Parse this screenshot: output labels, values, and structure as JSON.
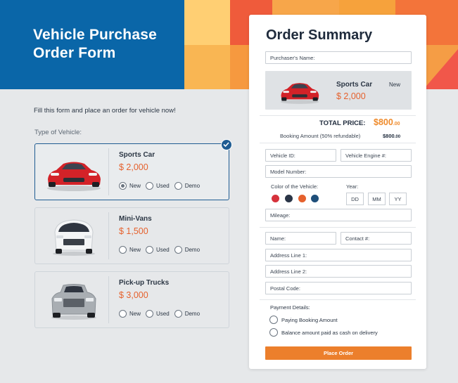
{
  "header": {
    "title": "Vehicle Purchase Order Form"
  },
  "intro_text": "Fill this form and place an order for vehicle now!",
  "vehicle_type_label": "Type of Vehicle:",
  "vehicles": [
    {
      "name": "Sports Car",
      "price": "$ 2,000",
      "icon": "sports-car-icon",
      "selected": true,
      "options": [
        "New",
        "Used",
        "Demo"
      ],
      "checked_option": "New"
    },
    {
      "name": "Mini-Vans",
      "price": "$ 1,500",
      "icon": "minivan-icon",
      "selected": false,
      "options": [
        "New",
        "Used",
        "Demo"
      ],
      "checked_option": null
    },
    {
      "name": "Pick-up Trucks",
      "price": "$ 3,000",
      "icon": "pickup-truck-icon",
      "selected": false,
      "options": [
        "New",
        "Used",
        "Demo"
      ],
      "checked_option": null
    }
  ],
  "order_summary": {
    "title": "Order Summary",
    "purchaser_placeholder": "Purchaser's Name:",
    "item": {
      "name": "Sports Car",
      "price": "$ 2,000",
      "condition": "New"
    },
    "total_label": "TOTAL PRICE:",
    "total_value": "$800",
    "total_cents": ".00",
    "booking_label": "Booking Amount (50% refundable)",
    "booking_value": "$800",
    "booking_cents": ".00",
    "fields": {
      "vehicle_id": "Vehicle ID:",
      "engine_no": "Vehicle Engine #:",
      "model_no": "Model Number:",
      "color_label": "Color of the Vehicle:",
      "year_label": "Year:",
      "dd": "DD",
      "mm": "MM",
      "yy": "YY",
      "mileage": "Mileage:",
      "name": "Name:",
      "contact": "Contact #:",
      "address1": "Address Line 1:",
      "address2": "Address Line 2:",
      "postal": "Postal Code:"
    },
    "colors": [
      "#d6323c",
      "#2a3547",
      "#e5612d",
      "#1f4f7a"
    ],
    "payment_label": "Payment Details:",
    "payment_options": [
      "Paying Booking Amount",
      "Balance amount paid as cash on delivery"
    ],
    "place_order_label": "Place Order"
  },
  "theme": {
    "header_blue": "#0a66a8",
    "accent_orange": "#ec7f2c",
    "price_orange": "#e5612d",
    "selected_border": "#1f5c92"
  }
}
